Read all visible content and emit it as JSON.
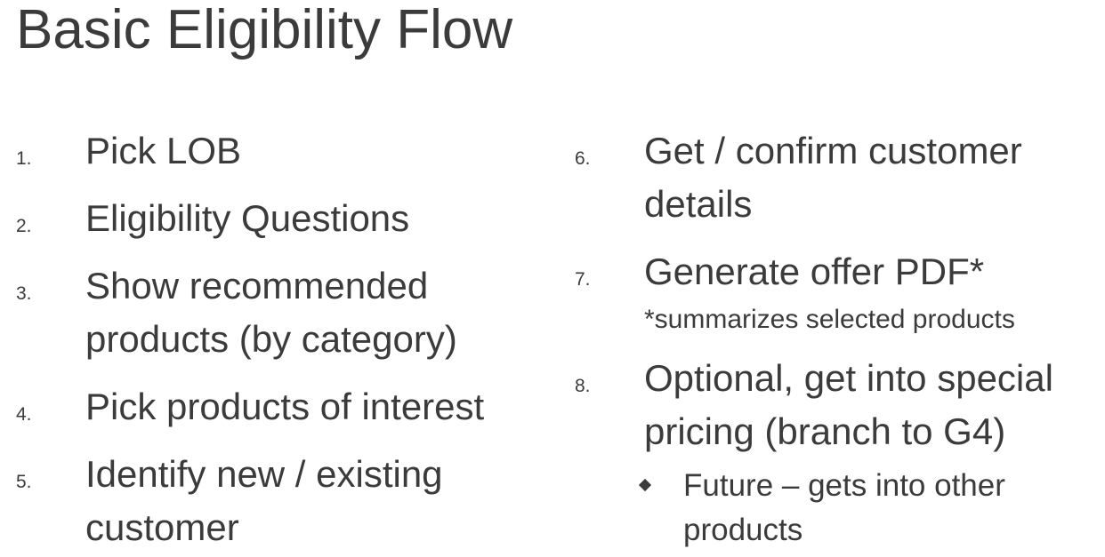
{
  "slide": {
    "title": "Basic Eligibility Flow",
    "left_items": [
      {
        "number": "1.",
        "text": "Pick LOB"
      },
      {
        "number": "2.",
        "text": "Eligibility Questions"
      },
      {
        "number": "3.",
        "text": "Show recommended products (by category)"
      },
      {
        "number": "4.",
        "text": "Pick products of interest"
      },
      {
        "number": "5.",
        "text": "Identify new / existing customer"
      }
    ],
    "right_items": [
      {
        "number": "6.",
        "text": "Get / confirm customer details"
      },
      {
        "number": "7.",
        "text": "Generate offer PDF*",
        "note": "*summarizes selected products"
      },
      {
        "number": "8.",
        "text": "Optional, get into special pricing (branch to G4)"
      }
    ],
    "sub_bullet": {
      "text": "Future – gets into other products"
    }
  }
}
